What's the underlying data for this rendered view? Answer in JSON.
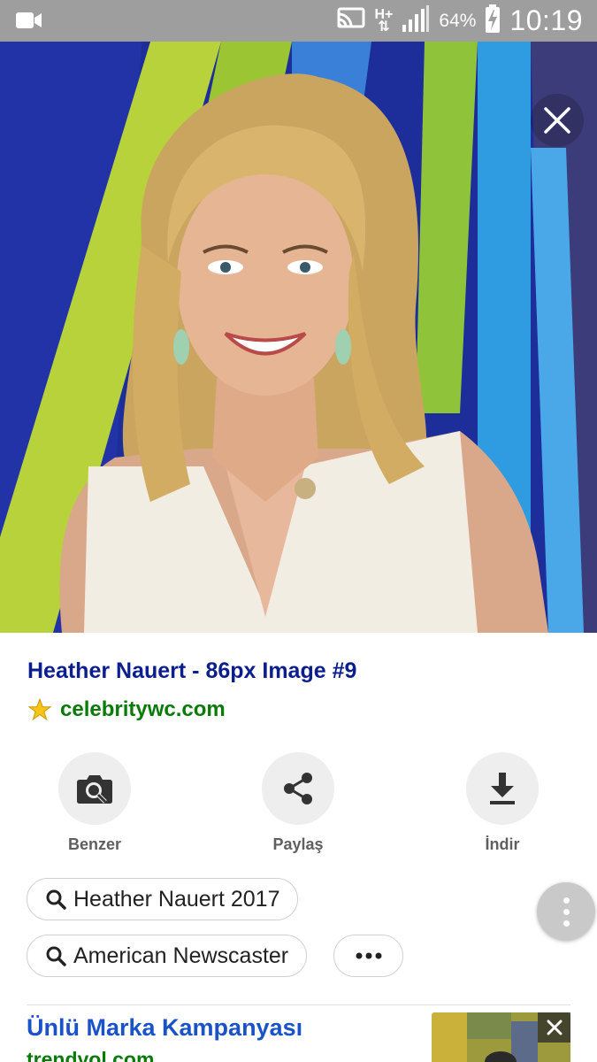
{
  "status_bar": {
    "network": "H+",
    "battery": "64%",
    "time": "10:19"
  },
  "result": {
    "title": "Heather Nauert - 86px Image #9",
    "domain": "celebritywc.com"
  },
  "actions": [
    {
      "label": "Benzer",
      "icon": "camera-search-icon"
    },
    {
      "label": "Paylaş",
      "icon": "share-icon"
    },
    {
      "label": "İndir",
      "icon": "download-icon"
    }
  ],
  "related_searches": [
    {
      "label": "Heather Nauert 2017"
    },
    {
      "label": "American Newscaster"
    }
  ],
  "ad": {
    "title": "Ünlü Marka Kampanyası",
    "domain": "trendyol.com"
  }
}
